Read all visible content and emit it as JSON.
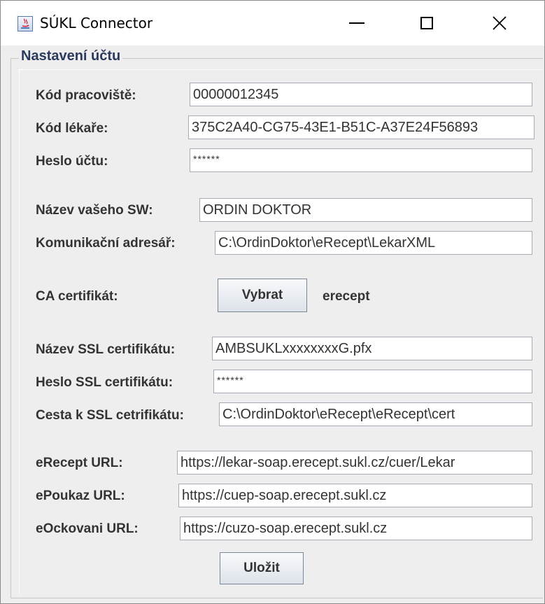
{
  "window": {
    "title": "SÚKL Connector",
    "minimize_glyph": "—",
    "close_glyph": "✕"
  },
  "section": {
    "legend": "Nastavení účtu"
  },
  "fields": {
    "kod_pracoviste": {
      "label": "Kód pracoviště:",
      "value": "00000012345"
    },
    "kod_lekare": {
      "label": "Kód lékaře:",
      "value": "375C2A40-CG75-43E1-B51C-A37E24F56893"
    },
    "heslo_uctu": {
      "label": "Heslo účtu:",
      "value": "******"
    },
    "nazev_sw": {
      "label": "Název vašeho SW:",
      "value": "ORDIN DOKTOR"
    },
    "kom_adresar": {
      "label": "Komunikační adresář:",
      "value": "C:\\OrdinDoktor\\eRecept\\LekarXML"
    },
    "ca_cert": {
      "label": "CA certifikát:",
      "button": "Vybrat",
      "selected": "erecept"
    },
    "ssl_nazev": {
      "label": "Název SSL certifikátu:",
      "value": "AMBSUKLxxxxxxxxG.pfx"
    },
    "ssl_heslo": {
      "label": "Heslo SSL certifikátu:",
      "value": "******"
    },
    "ssl_cesta": {
      "label": "Cesta k SSL cetrifikátu:",
      "value": "C:\\OrdinDoktor\\eRecept\\eRecept\\cert"
    },
    "erecept_url": {
      "label": "eRecept URL:",
      "value": "https://lekar-soap.erecept.sukl.cz/cuer/Lekar"
    },
    "epoukaz_url": {
      "label": "ePoukaz URL:",
      "value": "https://cuep-soap.erecept.sukl.cz"
    },
    "eockovani_url": {
      "label": "eOckovani URL:",
      "value": "https://cuzo-soap.erecept.sukl.cz"
    }
  },
  "save_button": "Uložit",
  "icons": [
    "java-app-icon",
    "minimize-icon",
    "maximize-icon",
    "close-icon"
  ]
}
